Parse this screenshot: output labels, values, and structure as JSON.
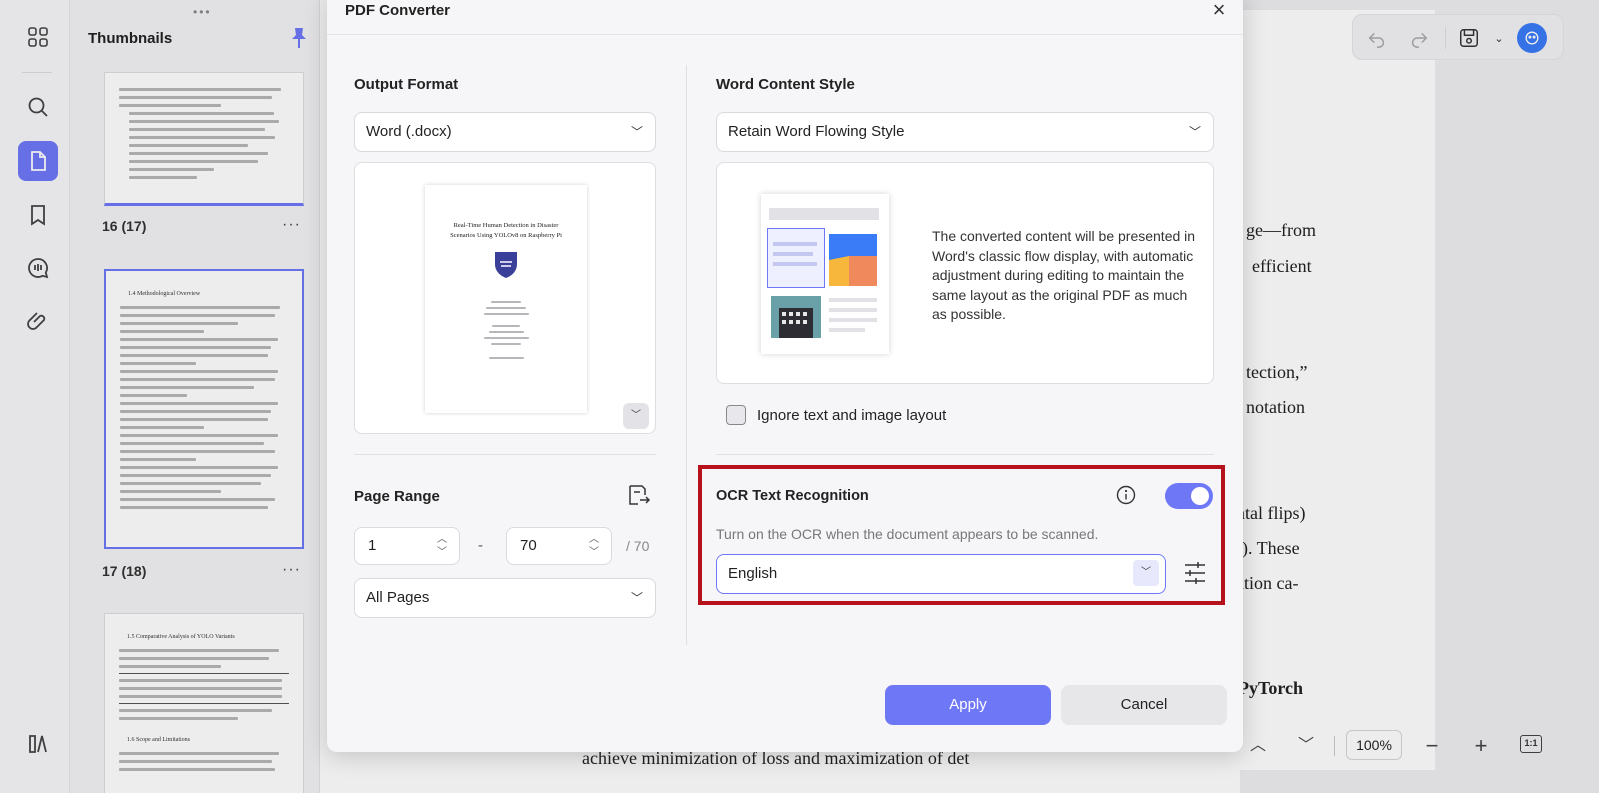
{
  "sidebar": {
    "thumbnails_title": "Thumbnails",
    "pages": [
      {
        "label": "16 (17)"
      },
      {
        "label": "17 (18)"
      }
    ],
    "more": "···"
  },
  "thumb_text": {
    "p17_heading": "1.4 Methodological Overview",
    "p18_heading": "1.5 Comparative Analysis of YOLO Variants",
    "p18_heading2": "1.6 Scope and Limitations"
  },
  "dialog": {
    "title": "PDF Converter",
    "close": "×",
    "output_format": {
      "title": "Output Format",
      "selected": "Word (.docx)"
    },
    "preview_doc": {
      "title_line1": "Real-Time Human Detection in Disaster",
      "title_line2": "Scenarios Using YOLOv8 on Raspberry Pi"
    },
    "word_style": {
      "title": "Word Content Style",
      "selected": "Retain Word Flowing Style",
      "description": "The converted content will be presented in Word's classic flow display, with automatic adjustment during editing to maintain the same layout as the original PDF as much as possible."
    },
    "ignore_layout_label": "Ignore text and image layout",
    "page_range": {
      "title": "Page Range",
      "from": "1",
      "dash": "-",
      "to": "70",
      "total": "/ 70",
      "scope": "All Pages"
    },
    "ocr": {
      "title": "OCR Text Recognition",
      "hint": "Turn on the OCR when the document appears to be scanned.",
      "language": "English",
      "enabled": true
    },
    "apply_label": "Apply",
    "cancel_label": "Cancel"
  },
  "document": {
    "fragments": [
      "ge—from",
      "efficient",
      "tection,”",
      "notation",
      "ntal flips)",
      "r). These",
      "ation ca-",
      "PyTorch"
    ],
    "bottom_line": "achieve minimization of loss and maximization of det"
  },
  "zoom": {
    "value": "100%",
    "fit_label": "1:1"
  },
  "colors": {
    "accent": "#6e78f7",
    "highlight": "#b5121b"
  }
}
